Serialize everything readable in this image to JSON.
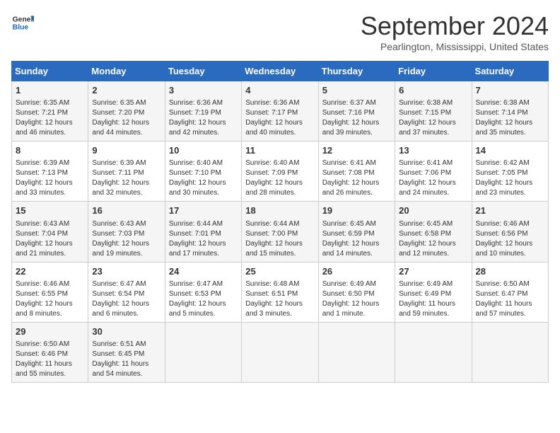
{
  "header": {
    "logo_line1": "General",
    "logo_line2": "Blue",
    "month": "September 2024",
    "location": "Pearlington, Mississippi, United States"
  },
  "weekdays": [
    "Sunday",
    "Monday",
    "Tuesday",
    "Wednesday",
    "Thursday",
    "Friday",
    "Saturday"
  ],
  "weeks": [
    [
      {
        "day": "1",
        "content": "Sunrise: 6:35 AM\nSunset: 7:21 PM\nDaylight: 12 hours and 46 minutes."
      },
      {
        "day": "2",
        "content": "Sunrise: 6:35 AM\nSunset: 7:20 PM\nDaylight: 12 hours and 44 minutes."
      },
      {
        "day": "3",
        "content": "Sunrise: 6:36 AM\nSunset: 7:19 PM\nDaylight: 12 hours and 42 minutes."
      },
      {
        "day": "4",
        "content": "Sunrise: 6:36 AM\nSunset: 7:17 PM\nDaylight: 12 hours and 40 minutes."
      },
      {
        "day": "5",
        "content": "Sunrise: 6:37 AM\nSunset: 7:16 PM\nDaylight: 12 hours and 39 minutes."
      },
      {
        "day": "6",
        "content": "Sunrise: 6:38 AM\nSunset: 7:15 PM\nDaylight: 12 hours and 37 minutes."
      },
      {
        "day": "7",
        "content": "Sunrise: 6:38 AM\nSunset: 7:14 PM\nDaylight: 12 hours and 35 minutes."
      }
    ],
    [
      {
        "day": "8",
        "content": "Sunrise: 6:39 AM\nSunset: 7:13 PM\nDaylight: 12 hours and 33 minutes."
      },
      {
        "day": "9",
        "content": "Sunrise: 6:39 AM\nSunset: 7:11 PM\nDaylight: 12 hours and 32 minutes."
      },
      {
        "day": "10",
        "content": "Sunrise: 6:40 AM\nSunset: 7:10 PM\nDaylight: 12 hours and 30 minutes."
      },
      {
        "day": "11",
        "content": "Sunrise: 6:40 AM\nSunset: 7:09 PM\nDaylight: 12 hours and 28 minutes."
      },
      {
        "day": "12",
        "content": "Sunrise: 6:41 AM\nSunset: 7:08 PM\nDaylight: 12 hours and 26 minutes."
      },
      {
        "day": "13",
        "content": "Sunrise: 6:41 AM\nSunset: 7:06 PM\nDaylight: 12 hours and 24 minutes."
      },
      {
        "day": "14",
        "content": "Sunrise: 6:42 AM\nSunset: 7:05 PM\nDaylight: 12 hours and 23 minutes."
      }
    ],
    [
      {
        "day": "15",
        "content": "Sunrise: 6:43 AM\nSunset: 7:04 PM\nDaylight: 12 hours and 21 minutes."
      },
      {
        "day": "16",
        "content": "Sunrise: 6:43 AM\nSunset: 7:03 PM\nDaylight: 12 hours and 19 minutes."
      },
      {
        "day": "17",
        "content": "Sunrise: 6:44 AM\nSunset: 7:01 PM\nDaylight: 12 hours and 17 minutes."
      },
      {
        "day": "18",
        "content": "Sunrise: 6:44 AM\nSunset: 7:00 PM\nDaylight: 12 hours and 15 minutes."
      },
      {
        "day": "19",
        "content": "Sunrise: 6:45 AM\nSunset: 6:59 PM\nDaylight: 12 hours and 14 minutes."
      },
      {
        "day": "20",
        "content": "Sunrise: 6:45 AM\nSunset: 6:58 PM\nDaylight: 12 hours and 12 minutes."
      },
      {
        "day": "21",
        "content": "Sunrise: 6:46 AM\nSunset: 6:56 PM\nDaylight: 12 hours and 10 minutes."
      }
    ],
    [
      {
        "day": "22",
        "content": "Sunrise: 6:46 AM\nSunset: 6:55 PM\nDaylight: 12 hours and 8 minutes."
      },
      {
        "day": "23",
        "content": "Sunrise: 6:47 AM\nSunset: 6:54 PM\nDaylight: 12 hours and 6 minutes."
      },
      {
        "day": "24",
        "content": "Sunrise: 6:47 AM\nSunset: 6:53 PM\nDaylight: 12 hours and 5 minutes."
      },
      {
        "day": "25",
        "content": "Sunrise: 6:48 AM\nSunset: 6:51 PM\nDaylight: 12 hours and 3 minutes."
      },
      {
        "day": "26",
        "content": "Sunrise: 6:49 AM\nSunset: 6:50 PM\nDaylight: 12 hours and 1 minute."
      },
      {
        "day": "27",
        "content": "Sunrise: 6:49 AM\nSunset: 6:49 PM\nDaylight: 11 hours and 59 minutes."
      },
      {
        "day": "28",
        "content": "Sunrise: 6:50 AM\nSunset: 6:47 PM\nDaylight: 11 hours and 57 minutes."
      }
    ],
    [
      {
        "day": "29",
        "content": "Sunrise: 6:50 AM\nSunset: 6:46 PM\nDaylight: 11 hours and 55 minutes."
      },
      {
        "day": "30",
        "content": "Sunrise: 6:51 AM\nSunset: 6:45 PM\nDaylight: 11 hours and 54 minutes."
      },
      {
        "day": "",
        "content": ""
      },
      {
        "day": "",
        "content": ""
      },
      {
        "day": "",
        "content": ""
      },
      {
        "day": "",
        "content": ""
      },
      {
        "day": "",
        "content": ""
      }
    ]
  ]
}
